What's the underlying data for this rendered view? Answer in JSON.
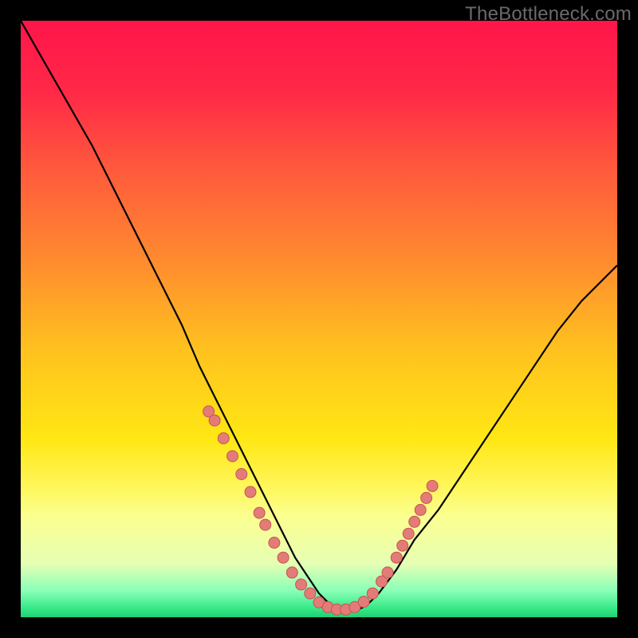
{
  "watermark": "TheBottleneck.com",
  "background": {
    "gradient_stops": [
      {
        "offset": 0.0,
        "color": "#ff154b"
      },
      {
        "offset": 0.12,
        "color": "#ff2947"
      },
      {
        "offset": 0.25,
        "color": "#ff5a3c"
      },
      {
        "offset": 0.4,
        "color": "#ff8a2f"
      },
      {
        "offset": 0.55,
        "color": "#ffc11f"
      },
      {
        "offset": 0.7,
        "color": "#ffe714"
      },
      {
        "offset": 0.78,
        "color": "#fff659"
      },
      {
        "offset": 0.83,
        "color": "#fbff8f"
      },
      {
        "offset": 0.91,
        "color": "#e6ffb4"
      },
      {
        "offset": 0.955,
        "color": "#8bffb8"
      },
      {
        "offset": 0.985,
        "color": "#35e987"
      },
      {
        "offset": 1.0,
        "color": "#1fcf76"
      }
    ]
  },
  "chart_data": {
    "type": "line",
    "title": "",
    "xlabel": "",
    "ylabel": "",
    "xlim": [
      0,
      100
    ],
    "ylim": [
      0,
      100
    ],
    "series": [
      {
        "name": "bottleneck-curve",
        "x": [
          0,
          4,
          8,
          12,
          15.5,
          19,
          23,
          27,
          30,
          33,
          36,
          38,
          40,
          42,
          44,
          46,
          48,
          50,
          52,
          54,
          56,
          58,
          60,
          63,
          66,
          70,
          74,
          78,
          82,
          86,
          90,
          94,
          98,
          100
        ],
        "values": [
          100,
          93,
          86,
          79,
          72,
          65,
          57,
          49,
          42,
          36,
          30,
          26,
          22,
          18,
          14,
          10,
          7,
          4,
          2,
          1,
          1,
          2,
          4,
          8,
          13,
          18,
          24,
          30,
          36,
          42,
          48,
          53,
          57,
          59
        ]
      }
    ],
    "marker_clusters": [
      {
        "name": "left-branch-markers",
        "points": [
          {
            "x": 31.5,
            "y": 34.5
          },
          {
            "x": 32.5,
            "y": 33.0
          },
          {
            "x": 34.0,
            "y": 30.0
          },
          {
            "x": 35.5,
            "y": 27.0
          },
          {
            "x": 37.0,
            "y": 24.0
          },
          {
            "x": 38.5,
            "y": 21.0
          },
          {
            "x": 40.0,
            "y": 17.5
          },
          {
            "x": 41.0,
            "y": 15.5
          },
          {
            "x": 42.5,
            "y": 12.5
          },
          {
            "x": 44.0,
            "y": 10.0
          },
          {
            "x": 45.5,
            "y": 7.5
          }
        ]
      },
      {
        "name": "valley-markers",
        "points": [
          {
            "x": 47.0,
            "y": 5.5
          },
          {
            "x": 48.5,
            "y": 4.0
          },
          {
            "x": 50.0,
            "y": 2.5
          },
          {
            "x": 51.5,
            "y": 1.7
          },
          {
            "x": 53.0,
            "y": 1.3
          },
          {
            "x": 54.5,
            "y": 1.3
          },
          {
            "x": 56.0,
            "y": 1.7
          },
          {
            "x": 57.5,
            "y": 2.6
          },
          {
            "x": 59.0,
            "y": 4.0
          }
        ]
      },
      {
        "name": "right-branch-markers",
        "points": [
          {
            "x": 60.5,
            "y": 6.0
          },
          {
            "x": 61.5,
            "y": 7.5
          },
          {
            "x": 63.0,
            "y": 10.0
          },
          {
            "x": 64.0,
            "y": 12.0
          },
          {
            "x": 65.0,
            "y": 14.0
          },
          {
            "x": 66.0,
            "y": 16.0
          },
          {
            "x": 67.0,
            "y": 18.0
          },
          {
            "x": 68.0,
            "y": 20.0
          },
          {
            "x": 69.0,
            "y": 22.0
          }
        ]
      }
    ],
    "marker_style": {
      "radius": 7,
      "fill": "#e37c78",
      "stroke": "#c9534f",
      "stroke_width": 1
    }
  }
}
